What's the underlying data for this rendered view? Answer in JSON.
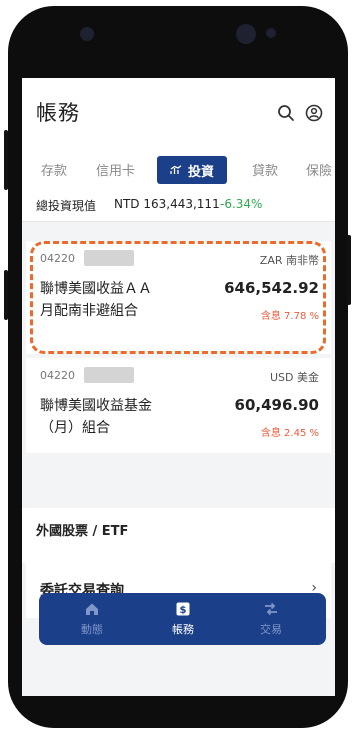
{
  "header": {
    "title": "帳務"
  },
  "tabs": [
    {
      "label": "存款"
    },
    {
      "label": "信用卡"
    },
    {
      "label": "投資"
    },
    {
      "label": "貸款"
    },
    {
      "label": "保險"
    }
  ],
  "summary": {
    "label": "總投資現值",
    "value": "NTD 163,443,111",
    "change": "-6.34%"
  },
  "holdings": [
    {
      "account": "04220",
      "currency": "ZAR 南非幣",
      "name_line1": "聯博美國收益ＡＡ",
      "name_line2": "月配南非避組合",
      "amount": "646,542.92",
      "yield": "含息 7.78 %"
    },
    {
      "account": "04220",
      "currency": "USD 美金",
      "name_line1": "聯博美國收益基金",
      "name_line2": "（月）組合",
      "amount": "60,496.90",
      "yield": "含息 2.45 %"
    }
  ],
  "section": {
    "title": "外國股票 / ETF"
  },
  "row": {
    "label": "委託交易查詢",
    "chevron": "›"
  },
  "nav": [
    {
      "label": "動態"
    },
    {
      "label": "帳務"
    },
    {
      "label": "交易"
    }
  ],
  "colors": {
    "accent": "#1c3f8a",
    "negative": "#2fa84f",
    "yield": "#ee5a3a",
    "highlight": "#ed6a2c"
  }
}
